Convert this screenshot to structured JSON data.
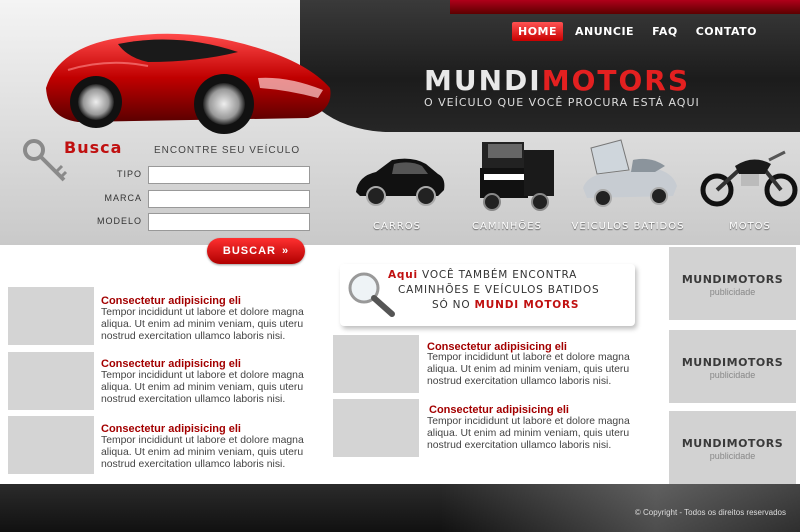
{
  "nav": [
    {
      "label": "HOME"
    },
    {
      "label": "ANUNCIE"
    },
    {
      "label": "FAQ"
    },
    {
      "label": "CONTATO"
    }
  ],
  "logo": {
    "part1": "MUNDI",
    "part2": "MOTORS"
  },
  "tagline": "O VEÍCULO QUE VOCÊ PROCURA ESTÁ AQUI",
  "search": {
    "title": "Busca",
    "subtitle": "ENCONTRE SEU VEÍCULO",
    "fields": [
      {
        "label": "TIPO",
        "value": ""
      },
      {
        "label": "MARCA",
        "value": ""
      },
      {
        "label": "MODELO",
        "value": ""
      }
    ],
    "button": "BUSCAR",
    "button_arrow": "»"
  },
  "categories": [
    {
      "label": "CARROS",
      "icon": "car-icon"
    },
    {
      "label": "CAMINHÕES",
      "icon": "truck-icon"
    },
    {
      "label": "VEICULOS BATIDOS",
      "icon": "damaged-car-icon"
    },
    {
      "label": "MOTOS",
      "icon": "motorcycle-icon"
    }
  ],
  "promo": {
    "line1_red": "Aqui",
    "line1_rest": " VOCÊ TAMBÉM ENCONTRA",
    "line2": "CAMINHÕES E VEÍCULOS BATIDOS",
    "line3_pre": "SÓ NO ",
    "line3_red": "MUNDI MOTORS"
  },
  "posts_left": [
    {
      "title": "Consectetur adipisicing eli",
      "lines": [
        "Tempor incididunt ut labore et dolore magna",
        "aliqua. Ut enim ad minim veniam, quis uteru",
        "nostrud exercitation ullamco laboris nisi."
      ]
    },
    {
      "title": "Consectetur adipisicing eli",
      "lines": [
        "Tempor incididunt ut labore et dolore magna",
        "aliqua. Ut enim ad minim veniam, quis uteru",
        "nostrud exercitation ullamco laboris nisi."
      ]
    },
    {
      "title": "Consectetur adipisicing eli",
      "lines": [
        "Tempor incididunt ut labore et dolore magna",
        "aliqua. Ut enim ad minim veniam, quis uteru",
        "nostrud exercitation ullamco laboris nisi."
      ]
    }
  ],
  "posts_center": [
    {
      "title": "Consectetur adipisicing eli",
      "lines": [
        "Tempor incididunt ut labore et dolore magna",
        "aliqua. Ut enim ad minim veniam, quis uteru",
        "nostrud exercitation ullamco laboris nisi."
      ]
    },
    {
      "title": "Consectetur adipisicing eli",
      "lines": [
        "Tempor incididunt ut labore et dolore magna",
        "aliqua. Ut enim ad minim veniam, quis uteru",
        "nostrud exercitation ullamco laboris nisi."
      ]
    }
  ],
  "ads": [
    {
      "logo": "MUNDIMOTORS",
      "sub": "publicidade"
    },
    {
      "logo": "MUNDIMOTORS",
      "sub": "publicidade"
    },
    {
      "logo": "MUNDIMOTORS",
      "sub": "publicidade"
    }
  ],
  "footer": {
    "copyright": "©  Copyright - Todos os direitos reservados"
  },
  "colors": {
    "accent": "#c01010",
    "dark": "#1c1c1c",
    "placeholder": "#d4d4d4"
  }
}
